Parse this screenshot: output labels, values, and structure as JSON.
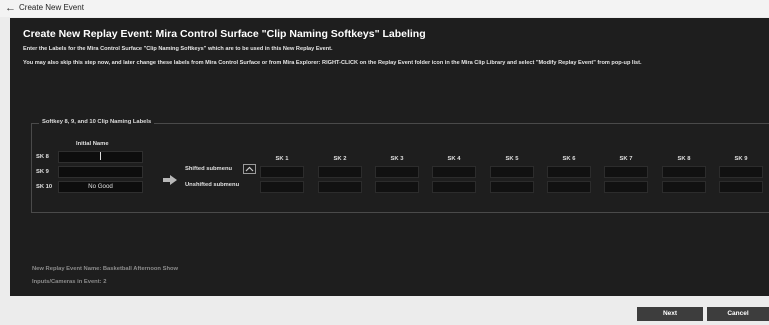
{
  "window": {
    "back_icon": "back-arrow-icon",
    "title": "Create New Event"
  },
  "dialog": {
    "heading": "Create New Replay Event: Mira Control Surface \"Clip Naming Softkeys\" Labeling",
    "instruction_1": "Enter the Labels for the Mira Control Surface \"Clip Naming Softkeys\" which are to be used in this New Replay Event.",
    "instruction_2": "You may also skip this step now, and later change these labels from Mira Control Surface or from Mira Explorer: RIGHT-CLICK on the Replay Event folder icon in the Mira Clip Library and select \"Modify Replay Event\" from pop-up list."
  },
  "softkeys": {
    "group_label": "Softkey 8, 9, and 10 Clip Naming Labels",
    "initial_name_header": "Initial Name",
    "rows": [
      {
        "label": "SK 8",
        "value": ""
      },
      {
        "label": "SK 9",
        "value": ""
      },
      {
        "label": "SK 10",
        "value": "No Good"
      }
    ],
    "shifted_label": "Shifted submenu",
    "unshifted_label": "Unshifted submenu",
    "columns": [
      "SK 1",
      "SK 2",
      "SK 3",
      "SK 4",
      "SK 5",
      "SK 6",
      "SK 7",
      "SK 8",
      "SK 9"
    ],
    "arrow_icon": "right-arrow-icon",
    "toggle_icon": "chevron-up-icon"
  },
  "summary": {
    "event_name_line": "New Replay Event Name: Basketball Afternoon Show",
    "inputs_line": "Inputs/Cameras in Event: 2"
  },
  "buttons": {
    "next": "Next",
    "cancel": "Cancel"
  },
  "colors": {
    "background": "#1e1e1e",
    "field": "#111111",
    "button": "#3d3d3d"
  }
}
